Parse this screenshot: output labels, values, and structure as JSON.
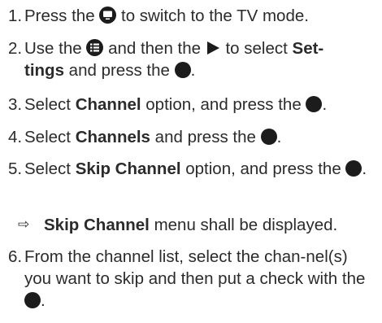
{
  "steps": [
    {
      "number": "1.",
      "before": "Press the",
      "icon": "tv-mode-icon",
      "after": "to switch to the TV mode."
    },
    {
      "number": "2.",
      "p1": "Use the",
      "icon1": "menu-list-icon",
      "p2": "and then the",
      "icon2": "play-arrow-icon",
      "p3": "to select",
      "bold": "Set-tings",
      "p4": "and press the",
      "icon3": "ok-button-icon",
      "end": "."
    },
    {
      "number": "3.",
      "p1": "Select",
      "bold": "Channel",
      "p2": "option, and press the",
      "icon": "ok-button-icon",
      "end": "."
    },
    {
      "number": "4.",
      "p1": "Select",
      "bold": "Channels",
      "p2": "and press the",
      "icon": "ok-button-icon",
      "end": "."
    },
    {
      "number": "5.",
      "p1": "Select",
      "bold": "Skip Channel",
      "p2": "option, and press the",
      "icon": "ok-button-icon",
      "end": "."
    },
    {
      "number": "6.",
      "p1": "From the channel list, select the chan-nel(s) you want to skip and then put a check with the",
      "icon": "ok-button-icon",
      "end": "."
    }
  ],
  "result": {
    "arrow": "⇨",
    "bold": "Skip Channel",
    "rest": "menu shall be displayed."
  }
}
